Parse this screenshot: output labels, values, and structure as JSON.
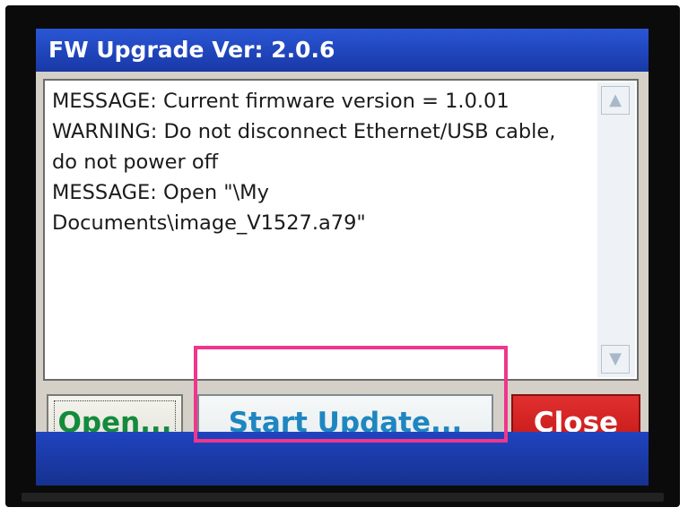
{
  "window": {
    "title": "FW Upgrade Ver: 2.0.6"
  },
  "log": {
    "lines": [
      "MESSAGE: Current firmware version = 1.0.01",
      "WARNING: Do not disconnect Ethernet/USB cable,",
      "do not power off",
      "MESSAGE: Open \"\\My",
      "Documents\\image_V1527.a79\""
    ]
  },
  "buttons": {
    "open_label": "Open...",
    "start_update_label": "Start Update...",
    "close_label": "Close"
  },
  "colors": {
    "title_bar": "#1838a6",
    "open_text": "#138a3c",
    "start_update_text": "#1e86c0",
    "close_button": "#c41616",
    "highlight_box": "#f0358c"
  },
  "icons": {
    "scroll_up": "scroll-up-arrow-icon",
    "scroll_down": "scroll-down-arrow-icon"
  }
}
